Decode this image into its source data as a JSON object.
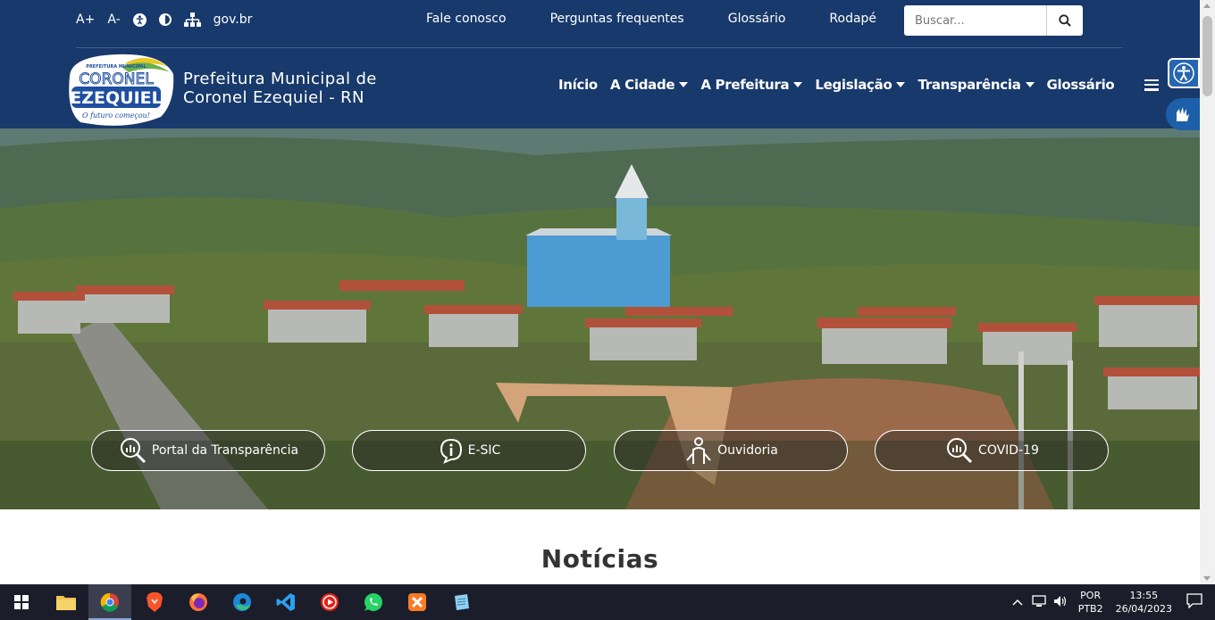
{
  "accessibility": {
    "increase_font": "A+",
    "decrease_font": "A-",
    "govbr": "gov.br"
  },
  "top_links": [
    "Fale conosco",
    "Perguntas frequentes",
    "Glossário",
    "Rodapé"
  ],
  "search": {
    "placeholder": "Buscar..."
  },
  "brand": {
    "logo_small": "PREFEITURA MUNICIPAL",
    "logo_line1": "CORONEL",
    "logo_line2": "EZEQUIEL",
    "logo_tagline": "O futuro começou!",
    "line1": "Prefeitura Municipal de",
    "line2": "Coronel Ezequiel - RN"
  },
  "main_nav": [
    {
      "label": "Início",
      "dropdown": false
    },
    {
      "label": "A Cidade",
      "dropdown": true
    },
    {
      "label": "A Prefeitura",
      "dropdown": true
    },
    {
      "label": "Legislação",
      "dropdown": true
    },
    {
      "label": "Transparência",
      "dropdown": true
    },
    {
      "label": "Glossário",
      "dropdown": false
    }
  ],
  "quick_links": [
    {
      "label": "Portal da Transparência",
      "icon": "magnifier-chart-icon"
    },
    {
      "label": "E-SIC",
      "icon": "info-bubble-icon"
    },
    {
      "label": "Ouvidoria",
      "icon": "person-speaking-icon"
    },
    {
      "label": "COVID-19",
      "icon": "magnifier-chart-icon"
    }
  ],
  "section_title": "Notícias",
  "taskbar": {
    "lang1": "POR",
    "lang2": "PTB2",
    "time": "13:55",
    "date": "26/04/2023"
  }
}
